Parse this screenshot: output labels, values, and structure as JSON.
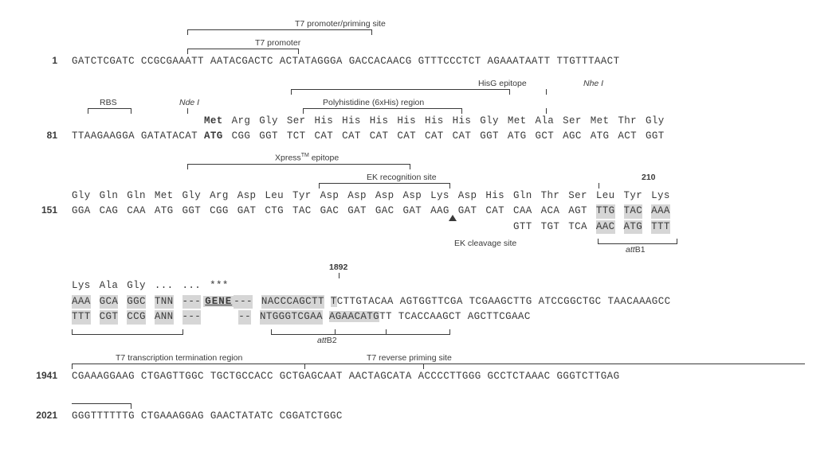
{
  "annotations": {
    "t7_promoter_priming": "T7 promoter/priming site",
    "t7_promoter": "T7 promoter",
    "rbs": "RBS",
    "nde1": "Nde I",
    "polyhis": "Polyhistidine (6xHis) region",
    "hisg": "HisG epitope",
    "nhe1": "Nhe I",
    "xpress": "Xpress",
    "xpress_suffix": " epitope",
    "ek_recog": "EK recognition site",
    "ek_cleave": "EK cleavage site",
    "attb1": "attB1",
    "attb2": "attB2",
    "t7_term": "T7 transcription termination region",
    "t7_rev": "T7 reverse priming site",
    "gene": "GENE",
    "pos210": "210",
    "pos1892": "1892",
    "stars": "***"
  },
  "positions": {
    "p1": "1",
    "p81": "81",
    "p151": "151",
    "p1941": "1941",
    "p2021": "2021"
  },
  "row1": {
    "groups": [
      "GATCTCGATC",
      "CCGCGAAATT",
      "AATACGACTC",
      "ACTATAGGGA",
      "GACCACAACG",
      "GTTTCCCTCT",
      "AGAAATAATT",
      "TTGTTTAACT"
    ]
  },
  "row81": {
    "aa": [
      "Met",
      "Arg",
      "Gly",
      "Ser",
      "His",
      "His",
      "His",
      "His",
      "His",
      "His",
      "Gly",
      "Met",
      "Ala",
      "Ser",
      "Met",
      "Thr",
      "Gly"
    ],
    "prefix": [
      "TTAAGAAGGA",
      "GATATACAT"
    ],
    "codons": [
      "ATG",
      "CGG",
      "GGT",
      "TCT",
      "CAT",
      "CAT",
      "CAT",
      "CAT",
      "CAT",
      "CAT",
      "GGT",
      "ATG",
      "GCT",
      "AGC",
      "ATG",
      "ACT",
      "GGT"
    ]
  },
  "row151": {
    "aa": [
      "Gly",
      "Gln",
      "Gln",
      "Met",
      "Gly",
      "Arg",
      "Asp",
      "Leu",
      "Tyr",
      "Asp",
      "Asp",
      "Asp",
      "Asp",
      "Lys",
      "Asp",
      "His",
      "Gln",
      "Thr",
      "Ser",
      "Leu",
      "Tyr",
      "Lys"
    ],
    "codons": [
      "GGA",
      "CAG",
      "CAA",
      "ATG",
      "GGT",
      "CGG",
      "GAT",
      "CTG",
      "TAC",
      "GAC",
      "GAT",
      "GAC",
      "GAT",
      "AAG",
      "GAT",
      "CAT",
      "CAA",
      "ACA",
      "AGT",
      "TTG",
      "TAC",
      "AAA"
    ],
    "comp_tail": [
      "GTT",
      "TGT",
      "TCA",
      "AAC",
      "ATG",
      "TTT"
    ]
  },
  "rowGene": {
    "aa_pre": [
      "Lys",
      "Ala",
      "Gly",
      "...",
      "..."
    ],
    "top_pre": [
      "AAA",
      "GCA",
      "GGC",
      "TNN"
    ],
    "bot_pre": [
      "TTT",
      "CGT",
      "CCG",
      "ANN"
    ],
    "dash": "---",
    "dash2": "--",
    "t1": "NACCCAGCTT",
    "t2a": "T",
    "t2b": "CTTGTACAA",
    "t3": "AGTGGTTCGA",
    "t4": "TCGAAGCTTG",
    "t5": "ATCCGGCTGC",
    "t6": "TAACAAAGCC",
    "b1": "NTGGGTCGAA",
    "b2a": "AGAACATG",
    "b2b": "TT",
    "b3": "TCACCAAGCT",
    "b4": "AGCTTCGAAC"
  },
  "row1941": {
    "groups": [
      "CGAAAGGAAG",
      "CTGAGTTGGC",
      "TGCTGCCACC",
      "GCTGAGCAAT",
      "AACTAGCATA",
      "ACCCCTTGGG",
      "GCCTCTAAAC",
      "GGGTCTTGAG"
    ]
  },
  "row2021": {
    "groups": [
      "GGGTTTTTTG",
      "CTGAAAGGAG",
      "GAACTATATC",
      "CGGATCTGGC"
    ]
  }
}
